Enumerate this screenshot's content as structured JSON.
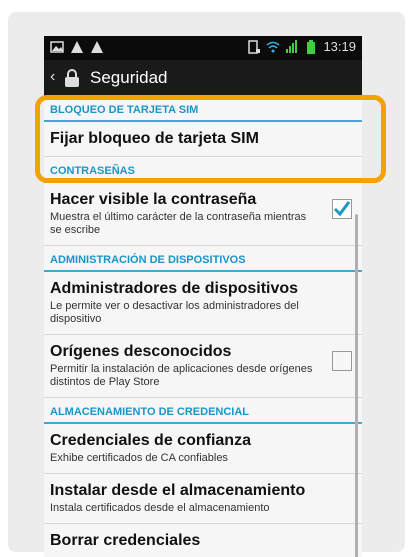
{
  "status": {
    "time": "13:19"
  },
  "header": {
    "title": "Seguridad"
  },
  "sections": {
    "sim": "BLOQUEO DE TARJETA SIM",
    "passwords": "CONTRASEÑAS",
    "admin": "ADMINISTRACIÓN DE DISPOSITIVOS",
    "cred": "ALMACENAMIENTO DE CREDENCIAL"
  },
  "items": {
    "sim_lock": "Fijar bloqueo de tarjeta SIM",
    "visible_pw": {
      "title": "Hacer visible la contraseña",
      "subtitle": "Muestra el último carácter de la contraseña mientras se escribe",
      "checked": true
    },
    "admins": {
      "title": "Administradores de dispositivos",
      "subtitle": "Le permite ver o desactivar los administradores del dispositivo"
    },
    "unknown": {
      "title": "Orígenes desconocidos",
      "subtitle": "Permitir la instalación de aplicaciones desde orígenes distintos de Play Store",
      "checked": false
    },
    "trust": {
      "title": "Credenciales de confianza",
      "subtitle": "Exhibe certificados de CA confiables"
    },
    "install": {
      "title": "Instalar desde el almacenamiento",
      "subtitle": "Instala certificados desde el almacenamiento"
    },
    "clear": {
      "title": "Borrar credenciales"
    }
  },
  "colors": {
    "accent": "#1a95c6",
    "highlight": "#f3a300"
  }
}
